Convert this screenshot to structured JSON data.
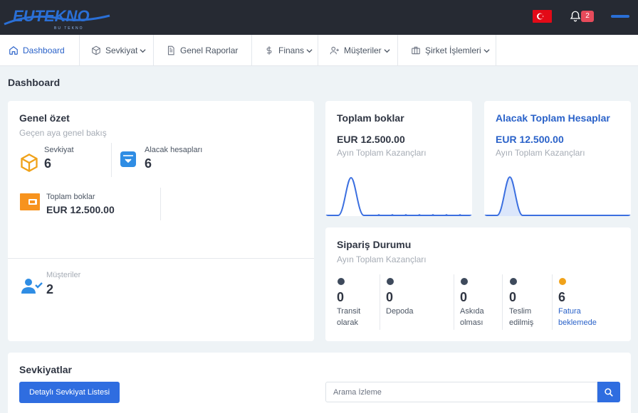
{
  "header": {
    "logo_text": "EUTEKNO",
    "logo_tagline": "BU TEKNO",
    "notification_count": "2",
    "language_flag": "turkey-flag-icon"
  },
  "nav": {
    "items": [
      {
        "label": "Dashboard",
        "icon": "home-icon",
        "active": true
      },
      {
        "label": "Sevkiyat",
        "icon": "box-icon",
        "dropdown": true
      },
      {
        "label": "Genel Raporlar",
        "icon": "document-icon"
      },
      {
        "label": "Finans",
        "icon": "dollar-icon",
        "dropdown": true
      },
      {
        "label": "Müşteriler",
        "icon": "user-plus-icon",
        "dropdown": true
      },
      {
        "label": "Şirket İşlemleri",
        "icon": "briefcase-icon",
        "dropdown": true
      }
    ]
  },
  "page": {
    "title": "Dashboard"
  },
  "summary": {
    "title": "Genel özet",
    "subtitle": "Geçen aya genel bakış",
    "shipment_label": "Sevkiyat",
    "shipment_value": "6",
    "receivables_label": "Alacak hesapları",
    "receivables_value": "6",
    "total_debt_label": "Toplam boklar",
    "total_debt_value": "EUR 12.500.00",
    "customers_label": "Müşteriler",
    "customers_value": "2"
  },
  "total_debt_card": {
    "title": "Toplam boklar",
    "value": "EUR 12.500.00",
    "subtitle": "Ayın Toplam Kazançları"
  },
  "receivables_card": {
    "title": "Alacak Toplam Hesaplar",
    "value": "EUR 12.500.00",
    "subtitle": "Ayın Toplam Kazançları"
  },
  "order_status": {
    "title": "Sipariş Durumu",
    "subtitle": "Ayın Toplam Kazançları",
    "items": [
      {
        "value": "0",
        "label_line1": "Transit",
        "label_line2": "olarak",
        "color": "#3e4a5c"
      },
      {
        "value": "0",
        "label_line1": "Depoda",
        "label_line2": "",
        "color": "#3e4a5c"
      },
      {
        "value": "0",
        "label_line1": "Askıda",
        "label_line2": "olması",
        "color": "#3e4a5c"
      },
      {
        "value": "0",
        "label_line1": "Teslim",
        "label_line2": "edilmiş",
        "color": "#3e4a5c"
      },
      {
        "value": "6",
        "label_line1": "Fatura",
        "label_line2": "beklemede",
        "color": "#f0a21a"
      }
    ]
  },
  "shipments": {
    "title": "Sevkiyatlar",
    "detail_button": "Detaylı Sevkiyat Listesi",
    "search_placeholder": "Arama İzleme"
  },
  "colors": {
    "accent": "#2f6de0",
    "topbar": "#262a33",
    "warning": "#f0a21a"
  }
}
